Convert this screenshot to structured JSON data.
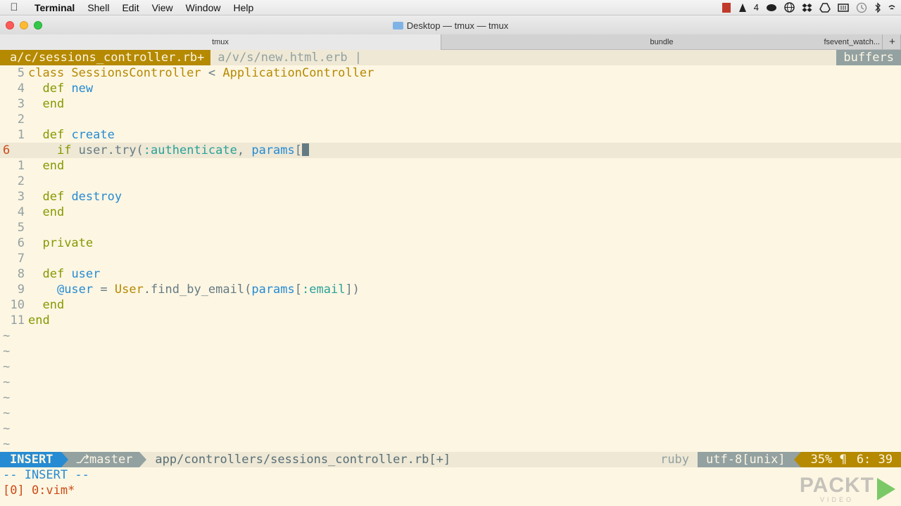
{
  "menubar": {
    "app": "Terminal",
    "items": [
      "Shell",
      "Edit",
      "View",
      "Window",
      "Help"
    ],
    "status_text": "4"
  },
  "window": {
    "title": "Desktop — tmux — tmux",
    "tabs": [
      "tmux",
      "bundle",
      "fsevent_watch..."
    ],
    "new_tab": "+"
  },
  "vim": {
    "buffers": {
      "active": "a/c/sessions_controller.rb+",
      "inactive": "a/v/s/new.html.erb |",
      "right_label": "buffers"
    },
    "lines": [
      {
        "num": "5",
        "code": [
          [
            "cls",
            "class "
          ],
          [
            "cls",
            "SessionsController"
          ],
          [
            "pl",
            " < "
          ],
          [
            "cls",
            "ApplicationController"
          ]
        ]
      },
      {
        "num": "4",
        "code": [
          [
            "pl",
            "  "
          ],
          [
            "kw",
            "def "
          ],
          [
            "fn",
            "new"
          ]
        ]
      },
      {
        "num": "3",
        "code": [
          [
            "pl",
            "  "
          ],
          [
            "kw",
            "end"
          ]
        ]
      },
      {
        "num": "2",
        "code": []
      },
      {
        "num": "1",
        "code": [
          [
            "pl",
            "  "
          ],
          [
            "kw",
            "def "
          ],
          [
            "fn",
            "create"
          ]
        ]
      },
      {
        "num": "6",
        "current": true,
        "code": [
          [
            "pl",
            "    "
          ],
          [
            "kw",
            "if "
          ],
          [
            "pl",
            "user.try("
          ],
          [
            "sym",
            ":authenticate"
          ],
          [
            "pl",
            ", "
          ],
          [
            "fn",
            "params"
          ],
          [
            "pl",
            "["
          ]
        ],
        "cursor": true
      },
      {
        "num": "1",
        "code": [
          [
            "pl",
            "  "
          ],
          [
            "kw",
            "end"
          ]
        ]
      },
      {
        "num": "2",
        "code": []
      },
      {
        "num": "3",
        "code": [
          [
            "pl",
            "  "
          ],
          [
            "kw",
            "def "
          ],
          [
            "fn",
            "destroy"
          ]
        ]
      },
      {
        "num": "4",
        "code": [
          [
            "pl",
            "  "
          ],
          [
            "kw",
            "end"
          ]
        ]
      },
      {
        "num": "5",
        "code": []
      },
      {
        "num": "6",
        "code": [
          [
            "pl",
            "  "
          ],
          [
            "kw",
            "private"
          ]
        ]
      },
      {
        "num": "7",
        "code": []
      },
      {
        "num": "8",
        "code": [
          [
            "pl",
            "  "
          ],
          [
            "kw",
            "def "
          ],
          [
            "fn",
            "user"
          ]
        ]
      },
      {
        "num": "9",
        "code": [
          [
            "pl",
            "    "
          ],
          [
            "iv",
            "@user"
          ],
          [
            "pl",
            " = "
          ],
          [
            "cls",
            "User"
          ],
          [
            "pl",
            ".find_by_email("
          ],
          [
            "fn",
            "params"
          ],
          [
            "pl",
            "["
          ],
          [
            "sym",
            ":email"
          ],
          [
            "pl",
            "])"
          ]
        ]
      },
      {
        "num": "10",
        "code": [
          [
            "pl",
            "  "
          ],
          [
            "kw",
            "end"
          ]
        ]
      },
      {
        "num": "11",
        "code": [
          [
            "kw",
            "end"
          ]
        ]
      }
    ],
    "tilde_count": 8,
    "tilde": "~",
    "status": {
      "mode": "INSERT",
      "branch": "⎇master",
      "file": "app/controllers/sessions_controller.rb[+]",
      "filetype": "ruby",
      "encoding": "utf-8[unix]",
      "percent": "35% ¶",
      "position": "6: 39"
    },
    "cmdline": "-- INSERT --",
    "tmux": "[0] 0:vim*"
  },
  "watermark": {
    "text": "PACKT",
    "sub": "VIDEO"
  },
  "colors": {
    "yellow": "#b58900",
    "blue": "#268bd2",
    "green": "#859900",
    "cyan": "#2aa198",
    "orange": "#cb4b16",
    "base": "#fdf6e3"
  }
}
